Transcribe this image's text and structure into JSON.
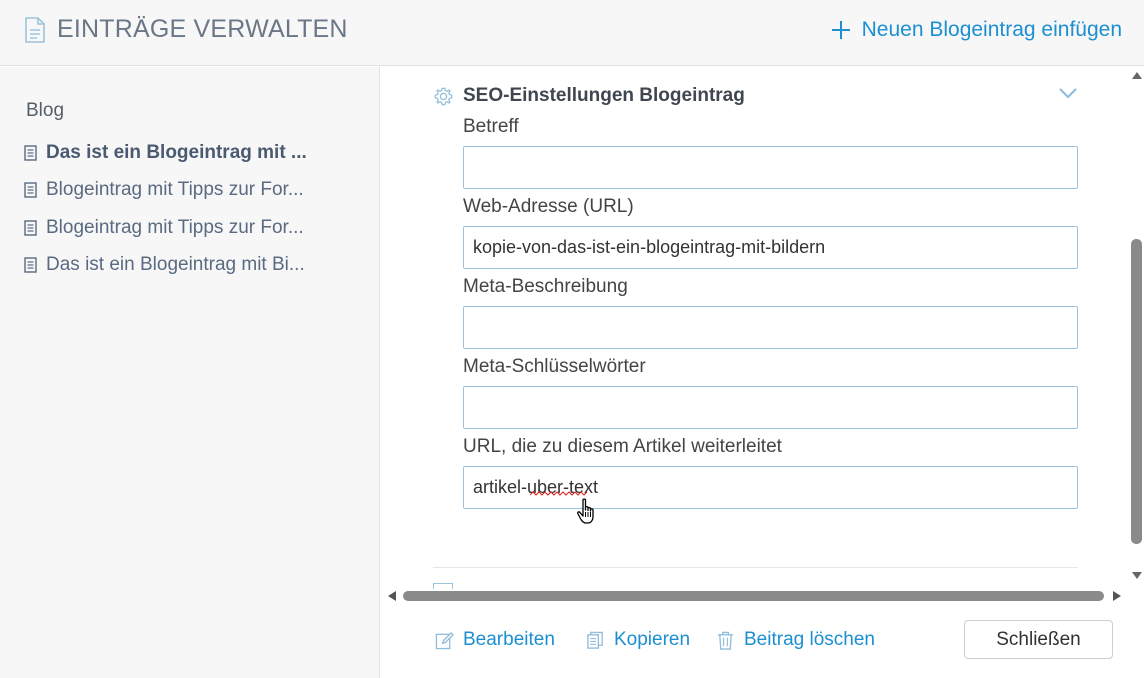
{
  "header": {
    "title": "EINTRÄGE VERWALTEN",
    "new_entry_label": "Neuen Blogeintrag einfügen"
  },
  "sidebar": {
    "blog_label": "Blog",
    "items": [
      {
        "label": "Das ist ein Blogeintrag mit ...",
        "active": true
      },
      {
        "label": "Blogeintrag mit Tipps zur For...",
        "active": false
      },
      {
        "label": "Blogeintrag mit Tipps zur For...",
        "active": false
      },
      {
        "label": "Das ist ein Blogeintrag mit Bi...",
        "active": false
      }
    ]
  },
  "seo": {
    "section_title": "SEO-Einstellungen Blogeintrag",
    "fields": [
      {
        "label": "Betreff",
        "value": ""
      },
      {
        "label": "Web-Adresse (URL)",
        "value": "kopie-von-das-ist-ein-blogeintrag-mit-bildern"
      },
      {
        "label": "Meta-Beschreibung",
        "value": ""
      },
      {
        "label": "Meta-Schlüsselwörter",
        "value": ""
      },
      {
        "label": "URL, die zu diesem Artikel weiterleitet",
        "value": "artikel-uber-text"
      }
    ]
  },
  "footer": {
    "edit_label": "Bearbeiten",
    "copy_label": "Kopieren",
    "delete_label": "Beitrag löschen",
    "close_label": "Schließen"
  },
  "colors": {
    "accent": "#1c8fd1",
    "input_border": "#9cc3dc",
    "sidebar_bg": "#f7f7f7"
  },
  "icons": [
    "document-icon",
    "plus-icon",
    "gear-icon",
    "chevron-down-icon",
    "pencil-icon",
    "copy-icon",
    "trash-icon",
    "hand-pointer-icon"
  ]
}
